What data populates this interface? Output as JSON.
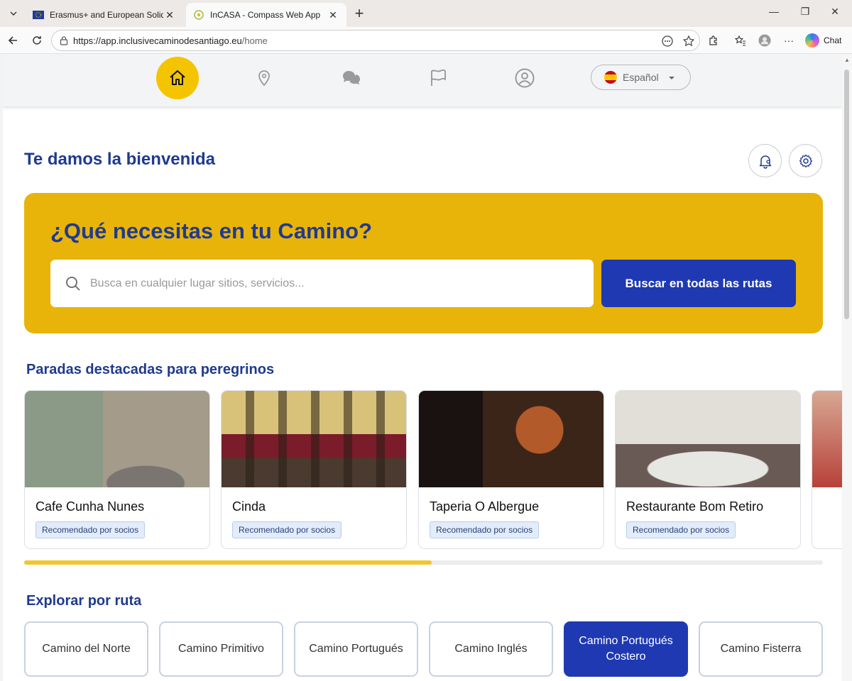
{
  "browser": {
    "tabs": [
      {
        "title": "Erasmus+ and European Solidarity",
        "active": false
      },
      {
        "title": "InCASA - Compass Web App",
        "active": true
      }
    ],
    "url_host": "https://app.inclusivecaminodesantiago.eu",
    "url_path": "/home",
    "chat_label": "Chat"
  },
  "nav": {
    "items": [
      "home-icon",
      "location-pin-icon",
      "chat-bubbles-icon",
      "flag-icon",
      "user-profile-icon"
    ],
    "active": "home-icon",
    "language": "Español"
  },
  "welcome": "Te damos la bienvenida",
  "hero": {
    "title": "¿Qué necesitas en tu Camino?",
    "search_placeholder": "Busca en cualquier lugar sitios, servicios...",
    "search_button": "Buscar en todas las rutas"
  },
  "featured": {
    "title": "Paradas destacadas para peregrinos",
    "cards": [
      {
        "name": "Cafe Cunha Nunes",
        "badge": "Recomendado por socios"
      },
      {
        "name": "Cinda",
        "badge": "Recomendado por socios"
      },
      {
        "name": "Taperia O Albergue",
        "badge": "Recomendado por socios"
      },
      {
        "name": "Restaurante Bom Retiro",
        "badge": "Recomendado por socios"
      }
    ],
    "scroll_progress": 0.51
  },
  "routes": {
    "title": "Explorar por ruta",
    "items": [
      "Camino del Norte",
      "Camino Primitivo",
      "Camino Portugués",
      "Camino Inglés",
      "Camino Portugués Costero",
      "Camino Fisterra"
    ],
    "selected": "Camino Portugués Costero"
  },
  "colors": {
    "accent_yellow": "#f5c400",
    "hero_yellow": "#e8b40a",
    "brand_blue": "#1f39b2",
    "heading_blue": "#1f3a8f"
  }
}
